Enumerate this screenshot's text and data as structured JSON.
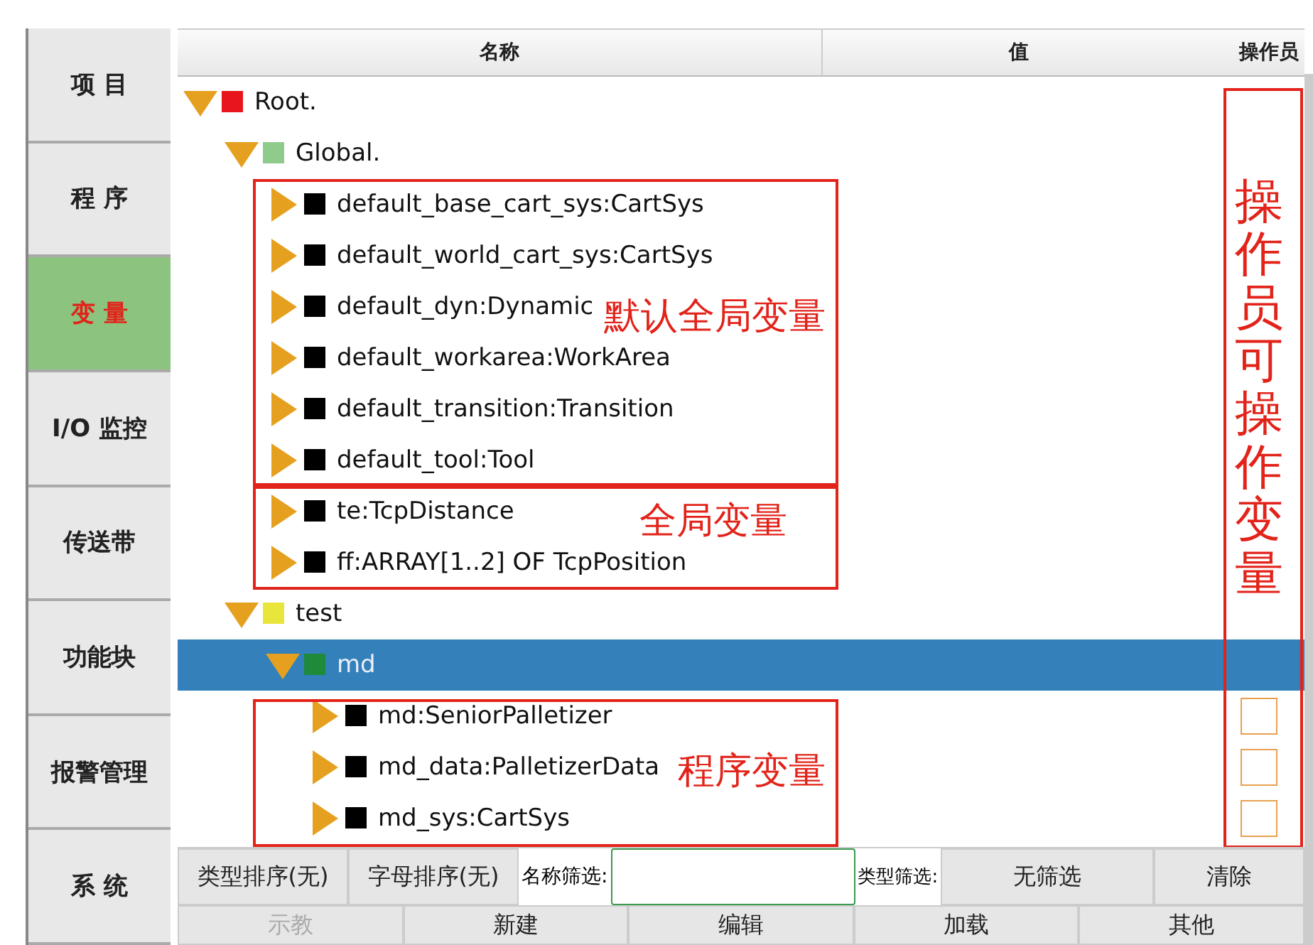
{
  "sidebar": {
    "items": [
      {
        "label": "项 目",
        "selected": false
      },
      {
        "label": "程 序",
        "selected": false
      },
      {
        "label": "变 量",
        "selected": true
      },
      {
        "label": "I/O 监控",
        "selected": false
      },
      {
        "label": "传送带",
        "selected": false
      },
      {
        "label": "功能块",
        "selected": false
      },
      {
        "label": "报警管理",
        "selected": false
      },
      {
        "label": "系 统",
        "selected": false
      }
    ]
  },
  "table": {
    "columns": [
      "名称",
      "值",
      "操作员"
    ],
    "rows": [
      {
        "label": "Root.",
        "color": "#e8161c",
        "expanded": true,
        "selected": false,
        "children": [
          {
            "label": "Global.",
            "color": "#8fcb8b",
            "expanded": true,
            "selected": false,
            "children": [
              {
                "label": "default_base_cart_sys:CartSys",
                "color": "#000000",
                "expanded": false,
                "selected": false
              },
              {
                "label": "default_world_cart_sys:CartSys",
                "color": "#000000",
                "expanded": false,
                "selected": false
              },
              {
                "label": "default_dyn:Dynamic",
                "color": "#000000",
                "expanded": false,
                "selected": false
              },
              {
                "label": "default_workarea:WorkArea",
                "color": "#000000",
                "expanded": false,
                "selected": false
              },
              {
                "label": "default_transition:Transition",
                "color": "#000000",
                "expanded": false,
                "selected": false
              },
              {
                "label": "default_tool:Tool",
                "color": "#000000",
                "expanded": false,
                "selected": false
              },
              {
                "label": "te:TcpDistance",
                "color": "#000000",
                "expanded": false,
                "selected": false
              },
              {
                "label": "ff:ARRAY[1..2] OF TcpPosition",
                "color": "#000000",
                "expanded": false,
                "selected": false
              }
            ]
          },
          {
            "label": "test",
            "color": "#e8e63a",
            "expanded": true,
            "selected": false,
            "children": [
              {
                "label": "md",
                "color": "#1e8a3a",
                "expanded": true,
                "selected": true,
                "children": [
                  {
                    "label": "md:SeniorPalletizer",
                    "color": "#000000",
                    "expanded": false,
                    "selected": false,
                    "operator_checked": false
                  },
                  {
                    "label": "md_data:PalletizerData",
                    "color": "#000000",
                    "expanded": false,
                    "selected": false,
                    "operator_checked": false
                  },
                  {
                    "label": "md_sys:CartSys",
                    "color": "#000000",
                    "expanded": false,
                    "selected": false,
                    "operator_checked": false
                  }
                ]
              }
            ]
          }
        ]
      }
    ]
  },
  "annotations": [
    {
      "kind": "horizontal",
      "text": "默认全局变量"
    },
    {
      "kind": "horizontal",
      "text": "全局变量"
    },
    {
      "kind": "horizontal",
      "text": "程序变量"
    },
    {
      "kind": "vertical",
      "text": "操作员可操作变量"
    }
  ],
  "filter_bar": {
    "type_sort": "类型排序(无)",
    "alpha_sort": "字母排序(无)",
    "name_filter_label": "名称筛选:",
    "type_filter_label": "类型筛选:",
    "type_filter_value": "无筛选",
    "clear": "清除"
  },
  "buttons": [
    {
      "label": "示教",
      "disabled": true
    },
    {
      "label": "新建",
      "disabled": false
    },
    {
      "label": "编辑",
      "disabled": false
    },
    {
      "label": "加载",
      "disabled": false
    },
    {
      "label": "其他",
      "disabled": false
    }
  ]
}
